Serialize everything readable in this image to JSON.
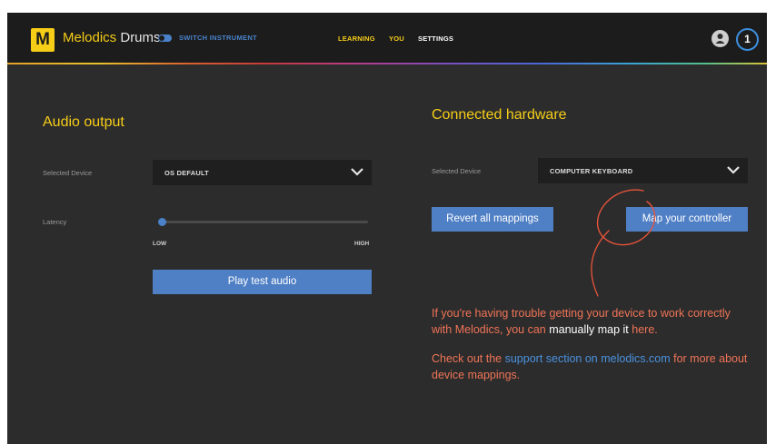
{
  "header": {
    "logo_letter": "M",
    "brand_name": "Melodics",
    "brand_product": "Drums",
    "switch_label": "SWITCH INSTRUMENT",
    "nav": {
      "learning": "LEARNING",
      "you": "YOU",
      "settings": "SETTINGS"
    },
    "level": "1",
    "icons": {
      "avatar": "user-avatar-icon",
      "level": "level-badge-icon",
      "toggle": "toggle-switch-icon"
    }
  },
  "audio_output": {
    "title": "Audio output",
    "selected_device_label": "Selected Device",
    "selected_device_value": "OS DEFAULT",
    "latency_label": "Latency",
    "latency_low": "LOW",
    "latency_high": "HIGH",
    "latency_level": 0.02,
    "test_button": "Play test audio"
  },
  "connected_hardware": {
    "title": "Connected hardware",
    "selected_device_label": "Selected Device",
    "selected_device_value": "COMPUTER KEYBOARD",
    "revert_button": "Revert all mappings",
    "map_button": "Map your controller",
    "help_1_prefix": "If you're having trouble getting your device to work correctly with Melodics, you can ",
    "help_1_highlight": "manually map it",
    "help_1_link": "here.",
    "help_2_prefix": "Check out the ",
    "help_2_link": "support section on melodics.com",
    "help_2_suffix": " for more about device mappings."
  },
  "colors": {
    "accent_yellow": "#f6cd17",
    "button_blue": "#4f7fc5",
    "link_blue": "#4a92e0",
    "help_orange": "#f07457",
    "annotation_red": "#e8543a"
  }
}
